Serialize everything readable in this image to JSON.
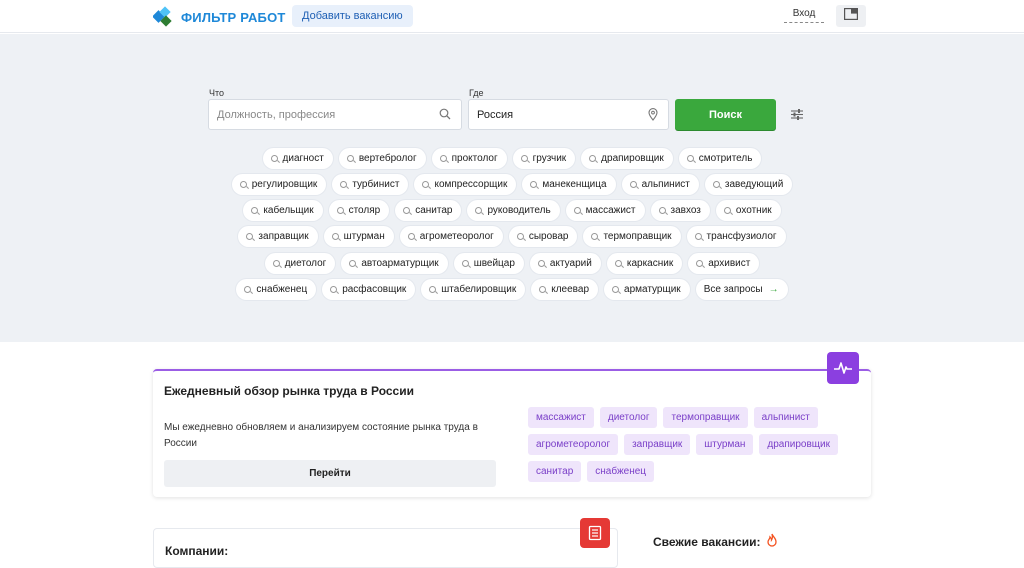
{
  "header": {
    "logo_text": "ФИЛЬТР РАБОТ",
    "add_vacancy": "Добавить вакансию",
    "login": "Вход"
  },
  "search": {
    "what_label": "Что",
    "what_placeholder": "Должность, профессия",
    "where_label": "Где",
    "where_value": "Россия",
    "button": "Поиск"
  },
  "chips": {
    "row1": [
      "диагност",
      "вертебролог",
      "проктолог",
      "грузчик",
      "драпировщик",
      "смотритель"
    ],
    "row2": [
      "регулировщик",
      "турбинист",
      "компрессорщик",
      "манекенщица",
      "альпинист",
      "заведующий"
    ],
    "row3": [
      "кабельщик",
      "столяр",
      "санитар",
      "руководитель",
      "массажист",
      "завхоз",
      "охотник"
    ],
    "row4": [
      "заправщик",
      "штурман",
      "агрометеоролог",
      "сыровар",
      "термоправщик",
      "трансфузиолог"
    ],
    "row5": [
      "диетолог",
      "автоарматурщик",
      "швейцар",
      "актуарий",
      "каркасник",
      "архивист"
    ],
    "row6": [
      "снабженец",
      "расфасовщик",
      "штабелировщик",
      "клеевар",
      "арматурщик"
    ],
    "all_requests": "Все запросы"
  },
  "market": {
    "title": "Ежедневный обзор рынка труда в России",
    "description": "Мы ежедневно обновляем и анализируем состояние рынка труда в России",
    "button": "Перейти",
    "tags": [
      "массажист",
      "диетолог",
      "термоправщик",
      "альпинист",
      "агрометеоролог",
      "заправщик",
      "штурман",
      "драпировщик",
      "санитар",
      "снабженец"
    ]
  },
  "companies": {
    "title": "Компании:"
  },
  "fresh": {
    "title": "Свежие вакансии:"
  },
  "colors": {
    "brand": "#1e88d8",
    "search_button": "#3aa83d",
    "accent_purple": "#8b3fe0",
    "red_badge": "#e53935"
  }
}
